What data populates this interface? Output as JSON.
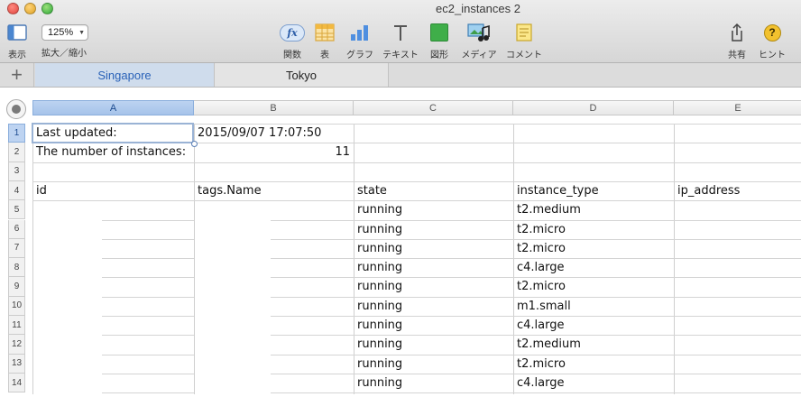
{
  "window": {
    "title": "ec2_instances 2"
  },
  "toolbar": {
    "view_label": "表示",
    "zoom_value": "125%",
    "zoom_label": "拡大／縮小",
    "function_glyph": "fx",
    "function_label": "関数",
    "table_label": "表",
    "chart_label": "グラフ",
    "text_label": "テキスト",
    "shape_label": "図形",
    "media_label": "メディア",
    "comment_label": "コメント",
    "share_label": "共有",
    "help_glyph": "?",
    "help_label": "ヒント"
  },
  "sheets": {
    "add_glyph": "+",
    "tabs": [
      "Singapore",
      "Tokyo"
    ],
    "active": "Singapore"
  },
  "grid": {
    "columns": [
      "A",
      "B",
      "C",
      "D",
      "E"
    ],
    "active_column": "A",
    "rows": [
      "1",
      "2",
      "3",
      "4",
      "5",
      "6",
      "7",
      "8",
      "9",
      "10",
      "11",
      "12",
      "13",
      "14"
    ],
    "active_row": "1",
    "meta": {
      "last_updated_label": "Last updated:",
      "last_updated_value": "2015/09/07 17:07:50",
      "instances_label": "The number of instances:",
      "instances_value": "11"
    },
    "headers": [
      "id",
      "tags.Name",
      "state",
      "instance_type",
      "ip_address"
    ],
    "records": [
      {
        "state": "running",
        "instance_type": "t2.medium"
      },
      {
        "state": "running",
        "instance_type": "t2.micro"
      },
      {
        "state": "running",
        "instance_type": "t2.micro"
      },
      {
        "state": "running",
        "instance_type": "c4.large"
      },
      {
        "state": "running",
        "instance_type": "t2.micro"
      },
      {
        "state": "running",
        "instance_type": "m1.small"
      },
      {
        "state": "running",
        "instance_type": "c4.large"
      },
      {
        "state": "running",
        "instance_type": "t2.medium"
      },
      {
        "state": "running",
        "instance_type": "t2.micro"
      },
      {
        "state": "running",
        "instance_type": "c4.large"
      }
    ]
  },
  "colors": {
    "active_tab_text": "#2a62b8",
    "selection_border": "#9ab3d5",
    "header_active": "#a6c3ea"
  }
}
